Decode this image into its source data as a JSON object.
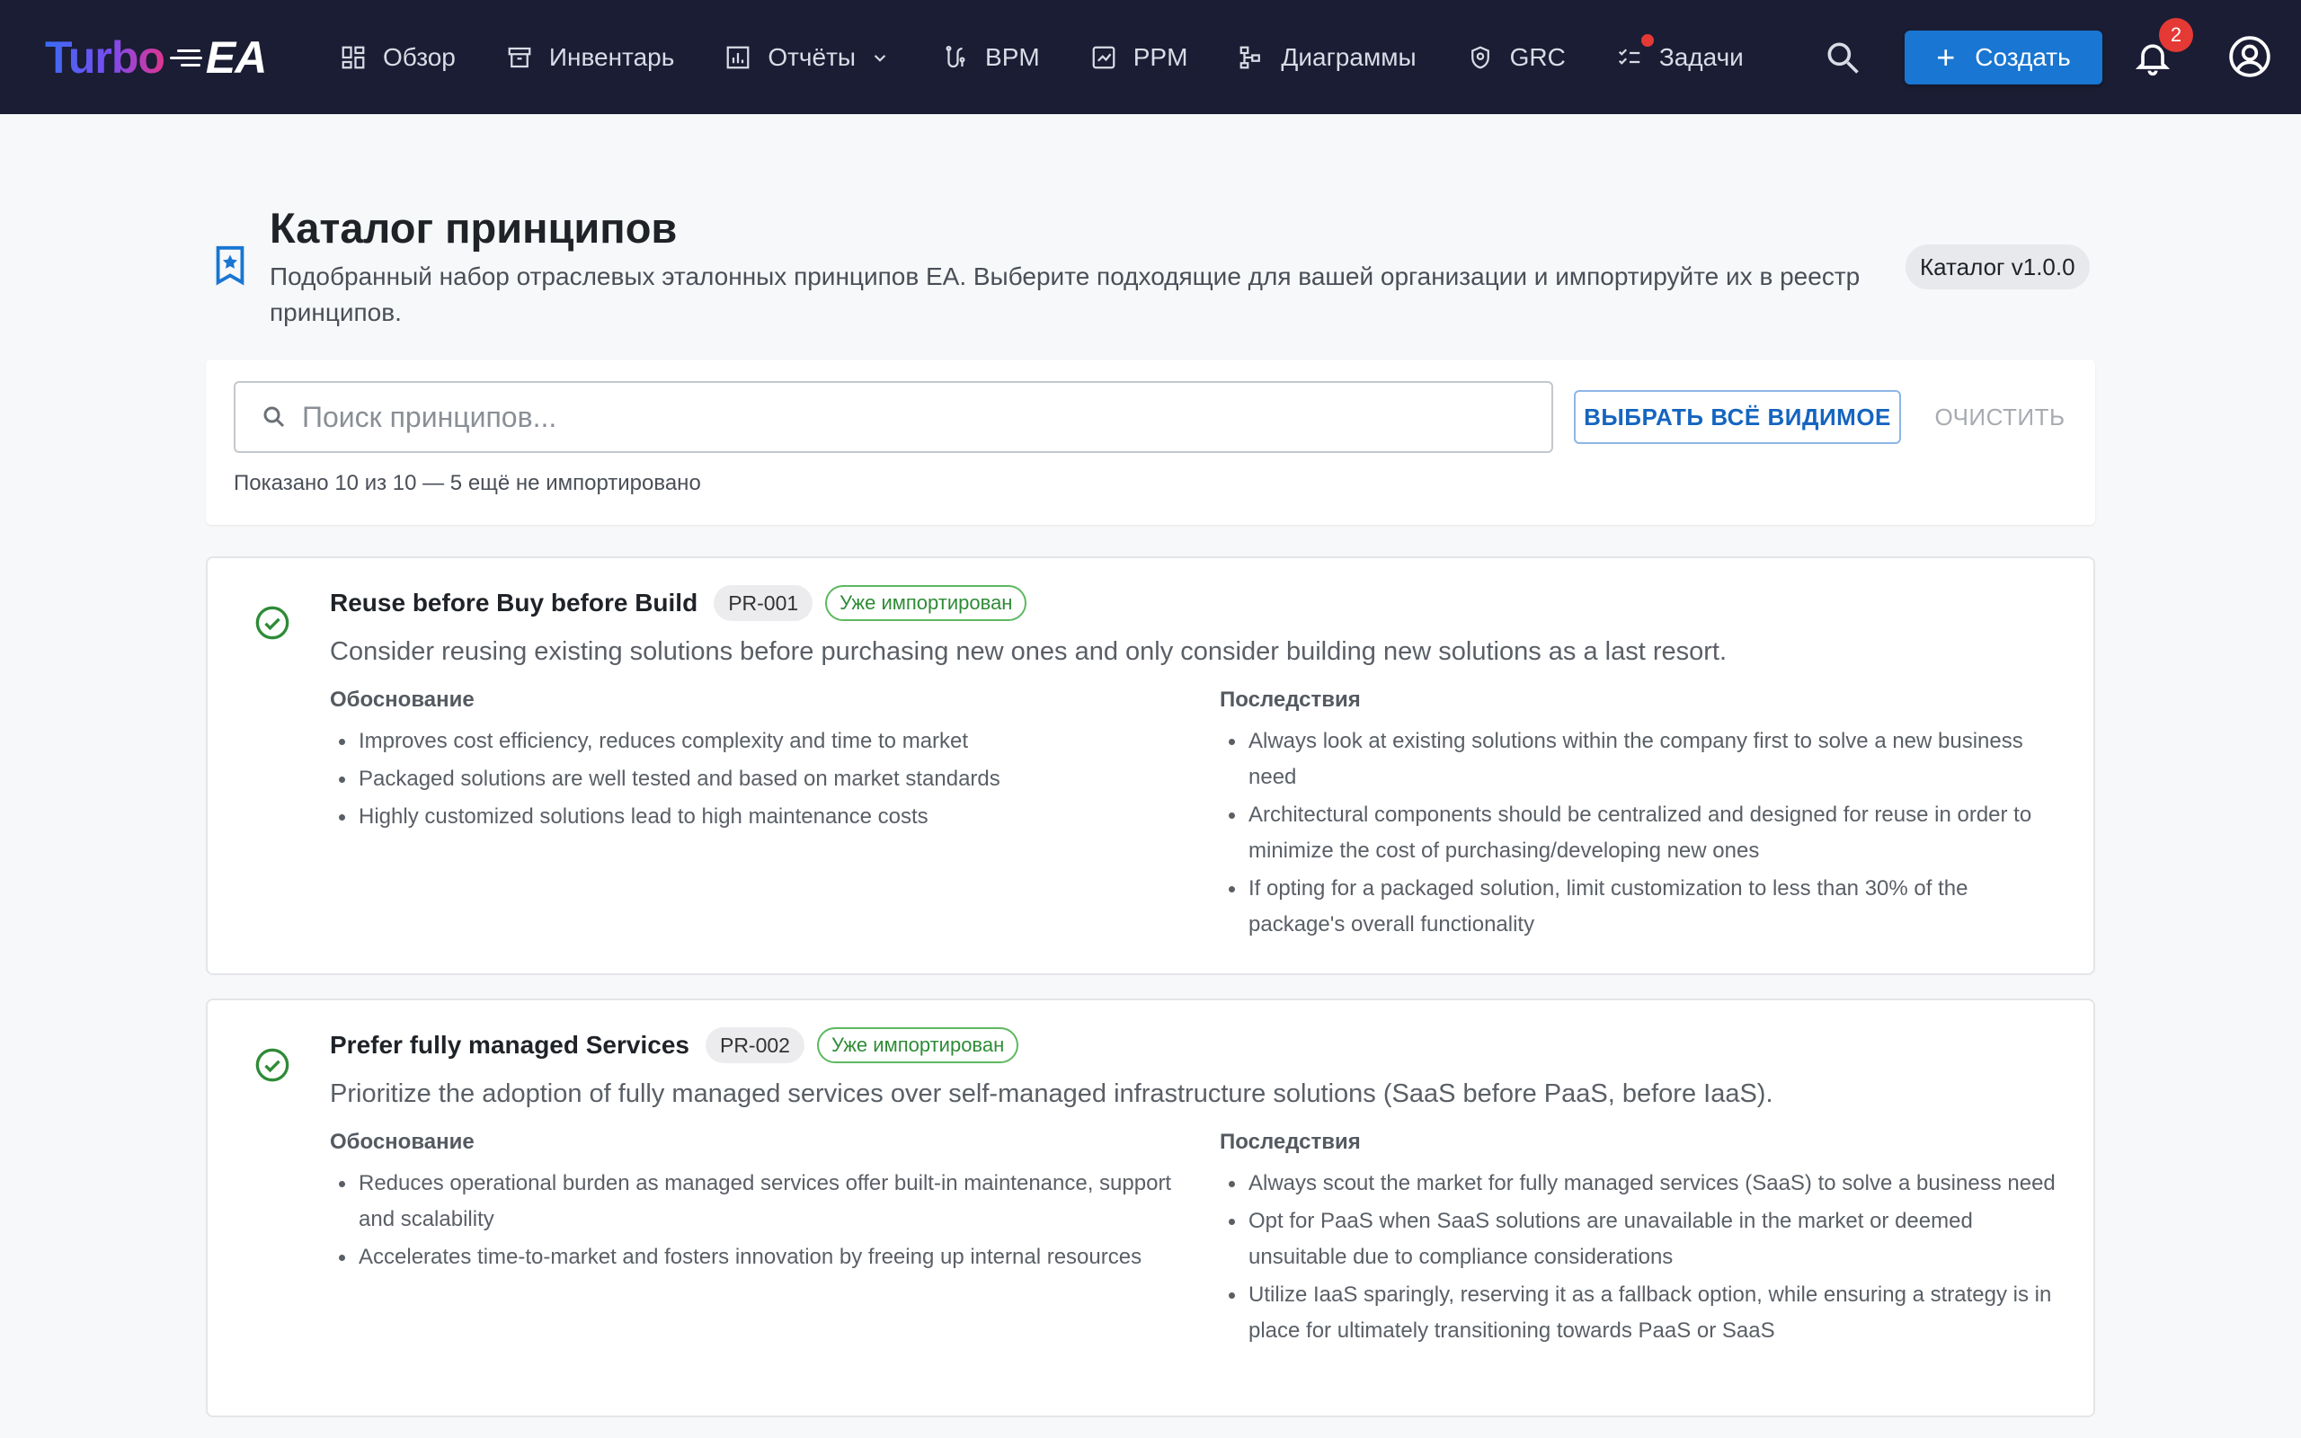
{
  "app": {
    "logo_text_1": "Turbo",
    "logo_text_2": "EA"
  },
  "nav": {
    "items": [
      {
        "label": "Обзор",
        "icon": "dashboard-icon"
      },
      {
        "label": "Инвентарь",
        "icon": "archive-icon"
      },
      {
        "label": "Отчёты",
        "icon": "bar-chart-icon"
      },
      {
        "label": "BPM",
        "icon": "process-icon"
      },
      {
        "label": "PPM",
        "icon": "portfolio-icon"
      },
      {
        "label": "Диаграммы",
        "icon": "diagram-icon"
      },
      {
        "label": "GRC",
        "icon": "shield-icon"
      },
      {
        "label": "Задачи",
        "icon": "checklist-icon"
      }
    ],
    "create_label": "Создать",
    "notification_count": "2"
  },
  "header": {
    "title": "Каталог принципов",
    "subtitle": "Подобранный набор отраслевых эталонных принципов EA. Выберите подходящие для вашей организации и импортируйте их в реестр принципов.",
    "version": "Каталог v1.0.0"
  },
  "search": {
    "placeholder": "Поиск принципов...",
    "value": "",
    "select_all_label": "ВЫБРАТЬ ВСЁ ВИДИМОЕ",
    "clear_label": "ОЧИСТИТЬ",
    "count_text": "Показано 10 из 10 — 5 ещё не импортировано"
  },
  "principles": [
    {
      "title": "Reuse before Buy before Build",
      "code": "PR-001",
      "status": "Уже импортирован",
      "description": "Consider reusing existing solutions before purchasing new ones and only consider building new solutions as a last resort.",
      "rationale_label": "Обоснование",
      "implications_label": "Последствия",
      "rationale": [
        "Improves cost efficiency, reduces complexity and time to market",
        "Packaged solutions are well tested and based on market standards",
        "Highly customized solutions lead to high maintenance costs"
      ],
      "implications": [
        "Always look at existing solutions within the company first to solve a new business need",
        "Architectural components should be centralized and designed for reuse in order to minimize the cost of purchasing/developing new ones",
        "If opting for a packaged solution, limit customization to less than 30% of the package's overall functionality"
      ]
    },
    {
      "title": "Prefer fully managed Services",
      "code": "PR-002",
      "status": "Уже импортирован",
      "description": "Prioritize the adoption of fully managed services over self-managed infrastructure solutions (SaaS before PaaS, before IaaS).",
      "rationale_label": "Обоснование",
      "implications_label": "Последствия",
      "rationale": [
        "Reduces operational burden as managed services offer built-in maintenance, support and scalability",
        "Accelerates time-to-market and fosters innovation by freeing up internal resources"
      ],
      "implications": [
        "Always scout the market for fully managed services (SaaS) to solve a business need",
        "Opt for PaaS when SaaS solutions are unavailable in the market or deemed unsuitable due to compliance considerations",
        "Utilize IaaS sparingly, reserving it as a fallback option, while ensuring a strategy is in place for ultimately transitioning towards PaaS or SaaS"
      ]
    }
  ],
  "colors": {
    "topbar": "#1a1d33",
    "primary": "#1976d2",
    "success": "#2e8b36",
    "badge": "#e53935"
  }
}
